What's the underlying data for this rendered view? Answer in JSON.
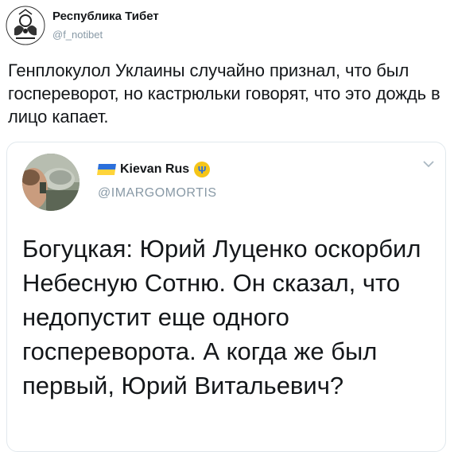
{
  "tweet": {
    "author_name": "Республика Тибет",
    "author_handle": "@f_notibet",
    "text": "Генплокулол Уклаины случайно признал, что был госпереворот, но кастрюльки говорят, что это дождь в лицо капает."
  },
  "quoted_tweet": {
    "author_name": "Kievan Rus",
    "author_handle": "@IMARGOMORTIS",
    "text": "Богуцкая: Юрий Луценко оскорбил Небесную Сотню. Он сказал, что недопустит еще одного госпереворота. А когда же был первый, Юрий Витальевич?",
    "flag_colors": [
      "#2b6fdb",
      "#ffd43b"
    ]
  },
  "icons": {
    "main_avatar": "tibet-emblem-icon",
    "menu": "chevron-down-icon",
    "badge": "trident-icon"
  }
}
